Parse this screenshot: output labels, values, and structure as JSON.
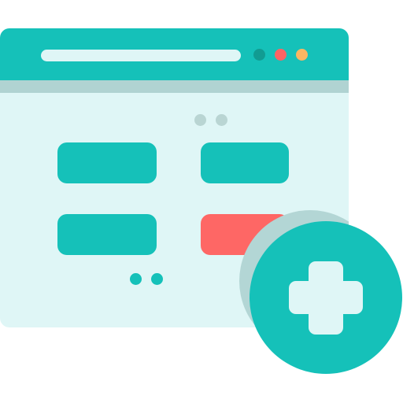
{
  "colors": {
    "primary_teal": "#15c1b9",
    "dark_teal": "#119c92",
    "light_surface": "#dff6f6",
    "shadow": "#b0d3d2",
    "pager_gray": "#b9d5d3",
    "accent_red": "#fe6765",
    "accent_coral": "#fe6363",
    "accent_orange": "#fbb662"
  },
  "icons": {
    "badge": "plus-icon",
    "window": "browser-window-icon"
  }
}
